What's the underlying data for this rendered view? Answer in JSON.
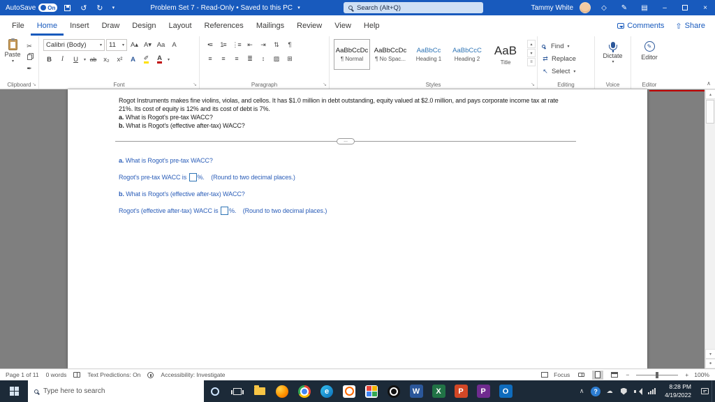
{
  "titlebar": {
    "autosave_label": "AutoSave",
    "autosave_state": "On",
    "doc_title": "Problem Set 7 - Read-Only • Saved to this PC",
    "search_label": "Search (Alt+Q)",
    "user_name": "Tammy White"
  },
  "menubar": {
    "items": [
      "File",
      "Home",
      "Insert",
      "Draw",
      "Design",
      "Layout",
      "References",
      "Mailings",
      "Review",
      "View",
      "Help"
    ],
    "active_item": "Home",
    "comments_label": "Comments",
    "share_label": "Share"
  },
  "ribbon": {
    "clipboard": {
      "paste_label": "Paste",
      "group_label": "Clipboard"
    },
    "font": {
      "family": "Calibri (Body)",
      "size": "11",
      "group_label": "Font"
    },
    "paragraph": {
      "group_label": "Paragraph"
    },
    "styles": {
      "group_label": "Styles",
      "items": [
        {
          "preview": "AaBbCcDc",
          "name": "¶ Normal"
        },
        {
          "preview": "AaBbCcDc",
          "name": "¶ No Spac..."
        },
        {
          "preview": "AaBbCc",
          "name": "Heading 1"
        },
        {
          "preview": "AaBbCcC",
          "name": "Heading 2"
        },
        {
          "preview": "AaB",
          "name": "Title"
        }
      ]
    },
    "editing": {
      "find": "Find",
      "replace": "Replace",
      "select": "Select",
      "group_label": "Editing"
    },
    "voice": {
      "dictate": "Dictate",
      "group_label": "Voice"
    },
    "editor": {
      "button": "Editor",
      "group_label": "Editor"
    }
  },
  "icons": {
    "undo": "↺",
    "redo": "↻",
    "caret_down": "▾",
    "caret_up": "▴",
    "minimize": "–",
    "close": "×",
    "cut": "✂",
    "format_painter": "✒",
    "grow_font": "A▴",
    "shrink_font": "A▾",
    "change_case": "Aa",
    "clear_formatting": "A",
    "bold": "B",
    "italic": "I",
    "underline": "U",
    "strikethrough": "ab",
    "subscript": "x₂",
    "superscript": "x²",
    "text_effects": "A",
    "highlight": "✐",
    "font_color": "A",
    "bullets": "•≡",
    "numbering": "1≡",
    "multilevel": "⋮≡",
    "outdent": "⇤",
    "indent": "⇥",
    "sort": "⇅",
    "pilcrow": "¶",
    "align_left": "≡",
    "align_center": "≡",
    "align_right": "≡",
    "justify": "≣",
    "line_spacing": "↕",
    "shading": "▨",
    "borders": "⊞",
    "replace": "⇄",
    "select": "↖",
    "chevron_up": "∧",
    "launcher": "↘",
    "gallery_more": "≡",
    "share": "⇧",
    "zoom_in": "+",
    "zoom_out": "−",
    "word": "W",
    "excel": "X",
    "powerpoint": "P",
    "pearson": "P",
    "outlook": "O",
    "edge": "e",
    "help": "?"
  },
  "document": {
    "paragraph": "Rogot Instruments makes fine violins, violas, and cellos. It has $1.0 million in debt outstanding, equity valued at $2.0 million, and pays corporate income tax at rate 21%. Its cost of equity is 12% and its cost of debt is 7%.",
    "q1_label": "a.",
    "q1_text": "What is Rogot's pre-tax WACC?",
    "q2_label": "b.",
    "q2_text": "What is Rogot's (effective after-tax) WACC?",
    "divider_button": "...",
    "part_a": {
      "question_label": "a.",
      "question": "What is Rogot's pre-tax WACC?",
      "answer_prefix": "Rogot's pre-tax WACC is",
      "answer_suffix": "%.",
      "hint": "(Round to two decimal places.)"
    },
    "part_b": {
      "question_label": "b.",
      "question": "What is Rogot's (effective after-tax) WACC?",
      "answer_prefix": "Rogot's (effective after-tax) WACC is",
      "answer_suffix": "%.",
      "hint": "(Round to two decimal places.)"
    }
  },
  "statusbar": {
    "page_info": "Page 1 of 11",
    "word_count": "0 words",
    "predictions": "Text Predictions: On",
    "accessibility": "Accessibility: Investigate",
    "focus_label": "Focus",
    "zoom_level": "100%"
  },
  "taskbar": {
    "search_placeholder": "Type here to search",
    "clock": {
      "time": "8:28 PM",
      "date": "4/19/2022"
    }
  },
  "colors": {
    "titlebar_blue": "#185abd",
    "question_blue": "#2a5db8",
    "heading_blue": "#2e74b5",
    "taskbar_dark": "#1c2a38",
    "page_gray": "#7f7f7f"
  }
}
